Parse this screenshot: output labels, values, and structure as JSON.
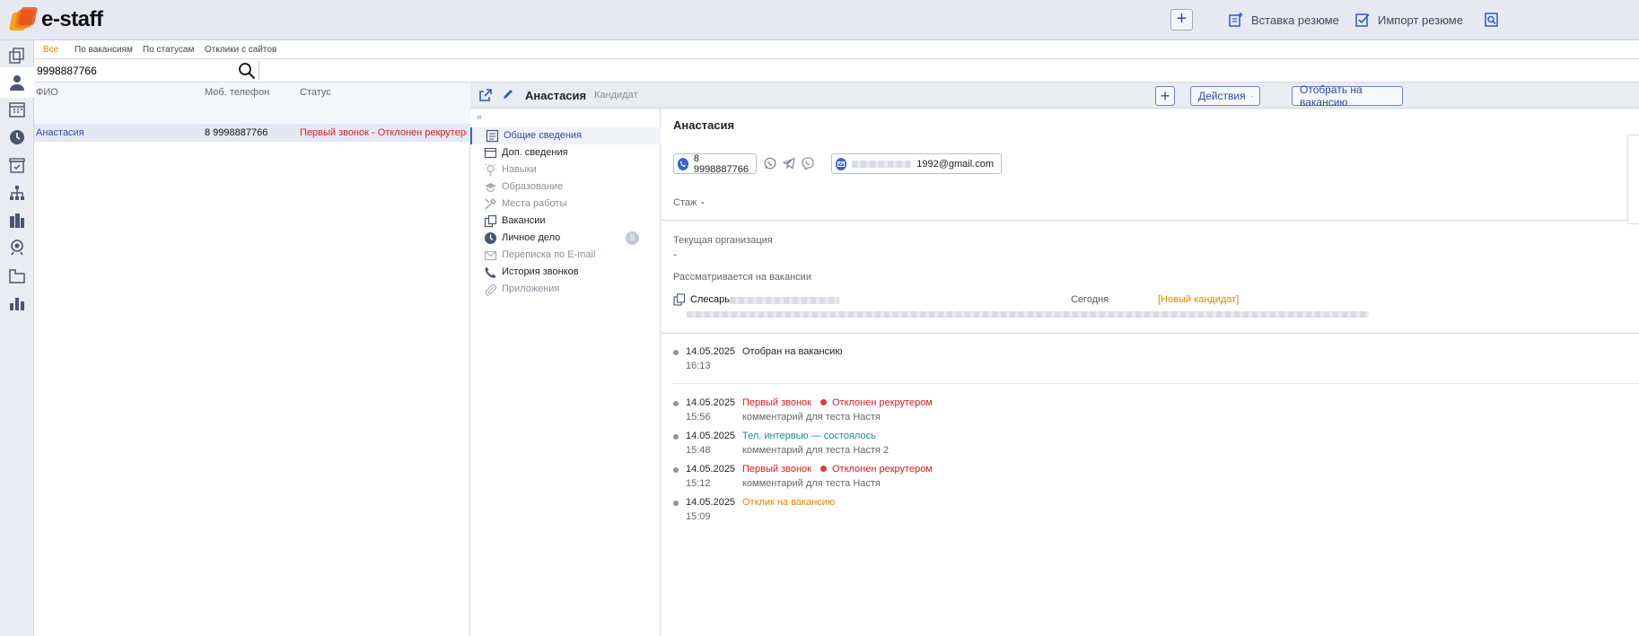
{
  "app": {
    "logo_text": "e-staff"
  },
  "topbar": {
    "insert_resume": "Вставка резюме",
    "import_resume": "Импорт резюме"
  },
  "rail": {
    "icons": [
      "vacancies-icon",
      "candidates-icon",
      "calendar-icon",
      "history-icon",
      "tasks-icon",
      "org-structure-icon",
      "companies-icon",
      "recruiting-icon",
      "divisions-icon",
      "reports-icon"
    ]
  },
  "tabs": [
    "Все",
    "По вакансиям",
    "По статусам",
    "Отклики с сайтов"
  ],
  "search": {
    "value": "9998887766"
  },
  "list": {
    "headers": {
      "name": "ФИО",
      "phone": "Моб. телефон",
      "status": "Статус"
    },
    "rows": [
      {
        "name": "Анастасия",
        "phone": "8 9998887766",
        "status": "Первый звонок - Отклонен рекрутером"
      }
    ]
  },
  "detail": {
    "name": "Анастасия",
    "role": "Кандидат",
    "actions_label": "Действия",
    "select_vacancy_label": "Отобрать на вакансию"
  },
  "sections": [
    {
      "label": "Общие сведения",
      "icon": "document-icon",
      "state": "active"
    },
    {
      "label": "Доп. сведения",
      "icon": "window-icon",
      "state": "normal"
    },
    {
      "label": "Навыки",
      "icon": "lightbulb-icon",
      "state": "muted"
    },
    {
      "label": "Образование",
      "icon": "graduation-cap-icon",
      "state": "muted"
    },
    {
      "label": "Места работы",
      "icon": "tools-icon",
      "state": "muted"
    },
    {
      "label": "Вакансии",
      "icon": "vacancy-icon",
      "state": "normal"
    },
    {
      "label": "Личное дело",
      "icon": "clock-icon",
      "state": "normal",
      "badge": "5"
    },
    {
      "label": "Переписка по E-mail",
      "icon": "envelope-icon",
      "state": "muted"
    },
    {
      "label": "История звонков",
      "icon": "phone-icon",
      "state": "normal"
    },
    {
      "label": "Приложения",
      "icon": "paperclip-icon",
      "state": "muted"
    }
  ],
  "content": {
    "name": "Анастасия",
    "phone": "8 9998887766",
    "email": "@gmail.com",
    "email_visible_suffix": "1992@gmail.com",
    "experience_label": "Стаж",
    "experience_value": "-",
    "current_org_label": "Текущая организация",
    "current_org_value": "-",
    "considered_label": "Рассматривается на вакансии",
    "vacancy_title": "Слесарь",
    "vacancy_date": "Сегодня",
    "vacancy_status": "[Новый кандидат]"
  },
  "timeline": [
    {
      "date": "14.05.2025",
      "time": "16:13",
      "text": "Отобран на вакансию",
      "color": "#222222"
    },
    {
      "date": "14.05.2025",
      "time": "15:56",
      "text": "Первый звонок",
      "substatus": "Отклонен рекрутером",
      "comment": "комментарий для теста Настя",
      "color": "#d61f26"
    },
    {
      "date": "14.05.2025",
      "time": "15:48",
      "text": "Тел. интервью — состоялось",
      "comment": "комментарий для теста Настя 2",
      "color": "#1a8b94"
    },
    {
      "date": "14.05.2025",
      "time": "15:12",
      "text": "Первый звонок",
      "substatus": "Отклонен рекрутером",
      "comment": "комментарий для теста Настя",
      "color": "#d61f26"
    },
    {
      "date": "14.05.2025",
      "time": "15:09",
      "text": "Отклик на вакансию",
      "color": "#e08a00"
    }
  ]
}
